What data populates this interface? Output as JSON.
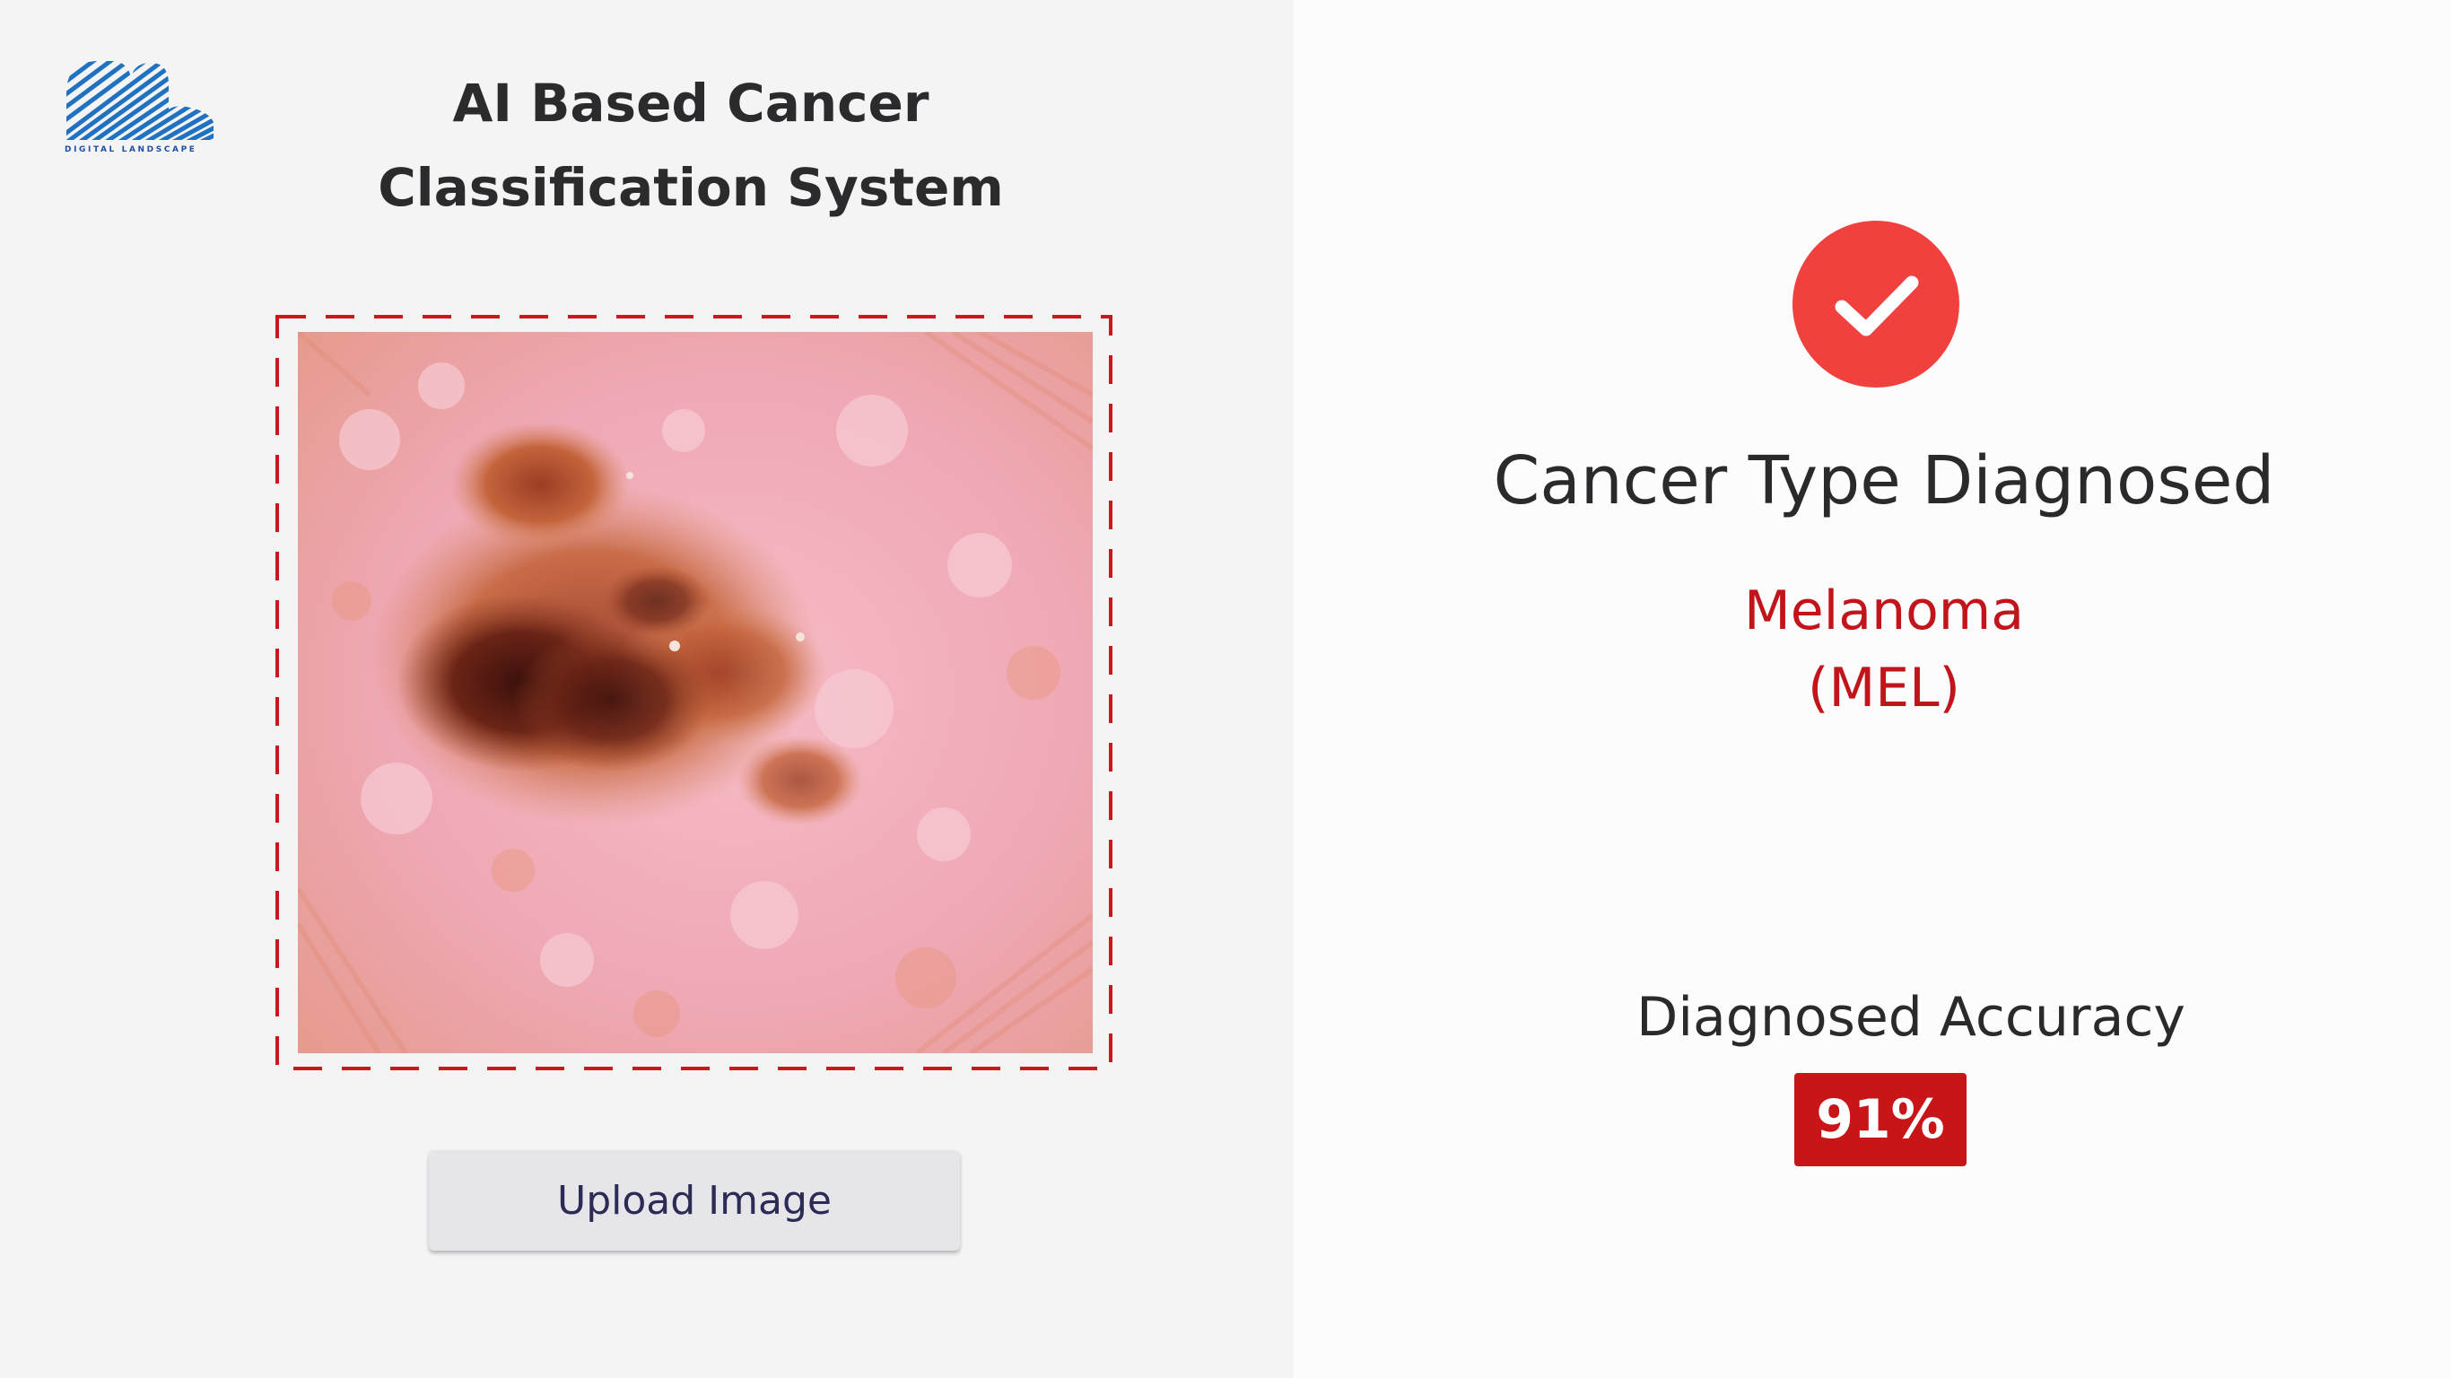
{
  "brand": {
    "logo_text": "DIGITAL LANDSCAPE",
    "logo_color": "#1d6fd1"
  },
  "app": {
    "title_line1": "AI Based Cancer",
    "title_line2": "Classification System"
  },
  "upload": {
    "button_label": "Upload Image",
    "dropzone_border_color": "#c8171d"
  },
  "result": {
    "heading": "Cancer Type Diagnosed",
    "cancer_name": "Melanoma",
    "cancer_code": "(MEL)",
    "status_icon": "check-icon",
    "status_color": "#f0413f",
    "name_color": "#c2141b"
  },
  "accuracy": {
    "label": "Diagnosed Accuracy",
    "value": "91%",
    "badge_color": "#c91418"
  }
}
